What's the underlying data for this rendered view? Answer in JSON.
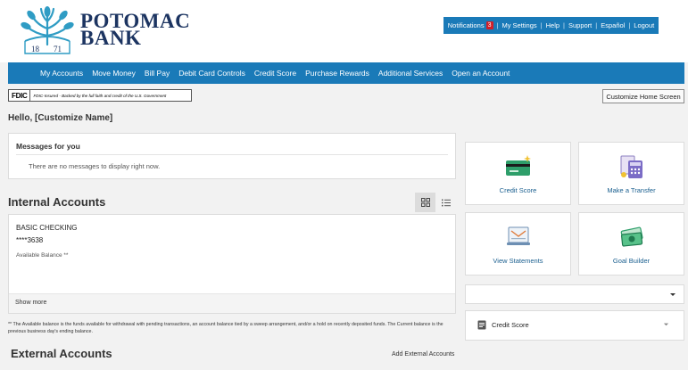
{
  "brand": {
    "name_line1": "POTOMAC",
    "name_line2": "BANK",
    "year_left": "18",
    "year_right": "71"
  },
  "utility_nav": {
    "notifications_label": "Notifications",
    "notifications_count": "3",
    "settings": "My Settings",
    "help": "Help",
    "support": "Support",
    "espanol": "Español",
    "logout": "Logout"
  },
  "main_nav": [
    "My Accounts",
    "Move Money",
    "Bill Pay",
    "Debit Card Controls",
    "Credit Score",
    "Purchase Rewards",
    "Additional Services",
    "Open an Account"
  ],
  "fdic": {
    "logo": "FDIC",
    "text": "FDIC-Insured - Backed by the full faith and credit of the U.S. Government"
  },
  "customize_button": "Customize Home Screen",
  "greeting": "Hello, [Customize Name]",
  "messages": {
    "title": "Messages for you",
    "empty": "There are no messages to display right now."
  },
  "internal_accounts": {
    "title": "Internal Accounts",
    "account": {
      "name": "BASIC CHECKING",
      "number": "****3638",
      "balance_label": "Available Balance **"
    },
    "show_more": "Show more"
  },
  "footnote": "** The Available balance is the funds available for withdrawal with pending transactions, an account balance tied by a sweep arrangement, and/or a hold on recently deposited funds. The Current balance is the previous business day's ending balance.",
  "external_accounts": {
    "title": "External Accounts",
    "add_link": "Add External Accounts"
  },
  "tiles": {
    "credit_score": "Credit Score",
    "make_transfer": "Make a Transfer",
    "view_statements": "View Statements",
    "goal_builder": "Goal Builder"
  },
  "widget": {
    "label": "Credit Score"
  },
  "colors": {
    "primary": "#1a7ab8",
    "brand_navy": "#1c3461",
    "logo_teal": "#2f9cc4",
    "badge_red": "#d0202a"
  },
  "icons": [
    "tree-logo-icon",
    "credit-card-icon",
    "calculator-icon",
    "statement-icon",
    "money-icon",
    "grid-view-icon",
    "list-view-icon",
    "chevron-down-icon",
    "document-icon"
  ]
}
